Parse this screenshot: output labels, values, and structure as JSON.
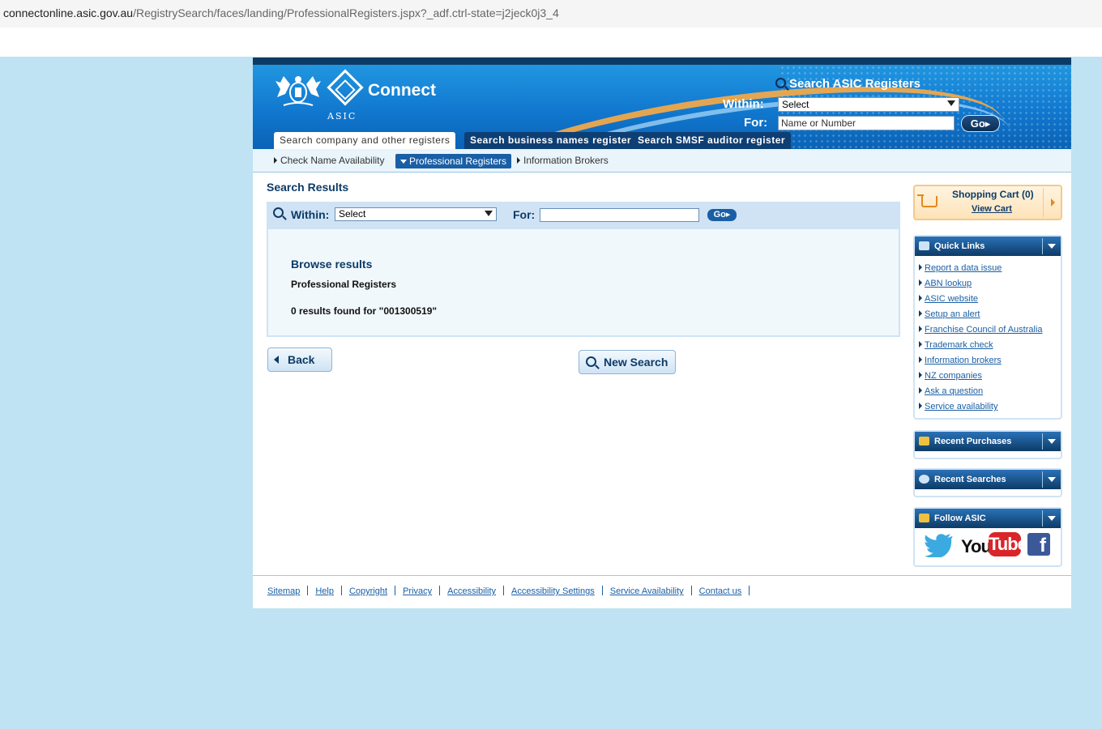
{
  "browser": {
    "url_host": "connectonline.asic.gov.au",
    "url_path": "/RegistrySearch/faces/landing/ProfessionalRegisters.jspx?_adf.ctrl-state=j2jeck0j3_4"
  },
  "header": {
    "logo_label": "ASIC",
    "brand": "Connect",
    "search_title": "Search ASIC Registers",
    "within_label": "Within:",
    "within_value": "Select",
    "for_label": "For:",
    "for_value": "Name or Number",
    "go_label": "Go"
  },
  "main_tabs": [
    {
      "label": "Search company and other registers",
      "active": true
    },
    {
      "label": "Search business names register",
      "active": false
    },
    {
      "label": "Search SMSF auditor register",
      "active": false
    }
  ],
  "sub_nav": [
    {
      "label": "Check Name Availability",
      "active": false
    },
    {
      "label": "Professional Registers",
      "active": true
    },
    {
      "label": "Information Brokers",
      "active": false
    }
  ],
  "content": {
    "heading": "Search Results",
    "within_label": "Within:",
    "within_value": "Select",
    "for_label": "For:",
    "go_label": "Go",
    "browse_heading": "Browse results",
    "register_name": "Professional Registers",
    "results_text": "0 results found for \"001300519\"",
    "back_label": "Back",
    "new_search_label": "New Search"
  },
  "sidebar": {
    "cart_title": "Shopping Cart (0)",
    "cart_link": "View Cart",
    "quick_links_title": "Quick Links",
    "quick_links": [
      "Report a data issue",
      "ABN lookup",
      "ASIC website",
      "Setup an alert",
      "Franchise Council of Australia",
      "Trademark check",
      "Information brokers",
      "NZ companies",
      "Ask a question",
      "Service availability"
    ],
    "recent_purchases_title": "Recent Purchases",
    "recent_searches_title": "Recent Searches",
    "follow_title": "Follow ASIC",
    "youtube_you": "You",
    "youtube_tube": "Tube",
    "facebook_glyph": "f"
  },
  "footer": {
    "links": [
      "Sitemap",
      "Help",
      "Copyright",
      "Privacy",
      "Accessibility",
      "Accessibility Settings",
      "Service Availability",
      "Contact us"
    ]
  },
  "colors": {
    "navy": "#0d3b66",
    "header_blue": "#1178cf",
    "link_blue": "#1a5fa5",
    "page_bg": "#bfe3f2",
    "cart_orange": "#e08a1e"
  }
}
